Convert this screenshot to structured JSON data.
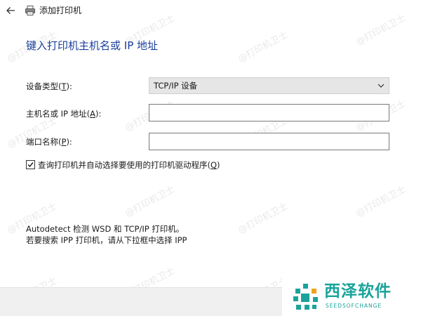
{
  "window": {
    "title": "添加打印机",
    "heading": "键入打印机主机名或 IP 地址"
  },
  "form": {
    "device_type": {
      "label_pre": "设备类型(",
      "label_key": "T",
      "label_post": "):",
      "selected": "TCP/IP 设备"
    },
    "hostname": {
      "label_pre": "主机名或 IP 地址(",
      "label_key": "A",
      "label_post": "):",
      "value": ""
    },
    "port_name": {
      "label_pre": "端口名称(",
      "label_key": "P",
      "label_post": "):",
      "value": ""
    },
    "auto_driver": {
      "checked": true,
      "label_pre": "查询打印机并自动选择要使用的打印机驱动程序(",
      "label_key": "Q",
      "label_post": ")"
    }
  },
  "info": {
    "line1": "Autodetect 检测 WSD 和 TCP/IP 打印机。",
    "line2": "若要搜索 IPP 打印机，请从下拉框中选择 IPP"
  },
  "watermark": {
    "text": "@打印机卫士"
  },
  "logo": {
    "name": "西泽软件",
    "subtitle": "SEEDSOFCHANGE",
    "color": "#1aa39a"
  },
  "icons": {
    "back": "back-arrow-icon",
    "printer": "printer-icon",
    "dropdown": "chevron-down-icon",
    "check": "checkmark-icon"
  },
  "colors": {
    "heading": "#1b3f9c",
    "select_bg": "#e6e6e6",
    "footer_bg": "#f0f0f0"
  }
}
